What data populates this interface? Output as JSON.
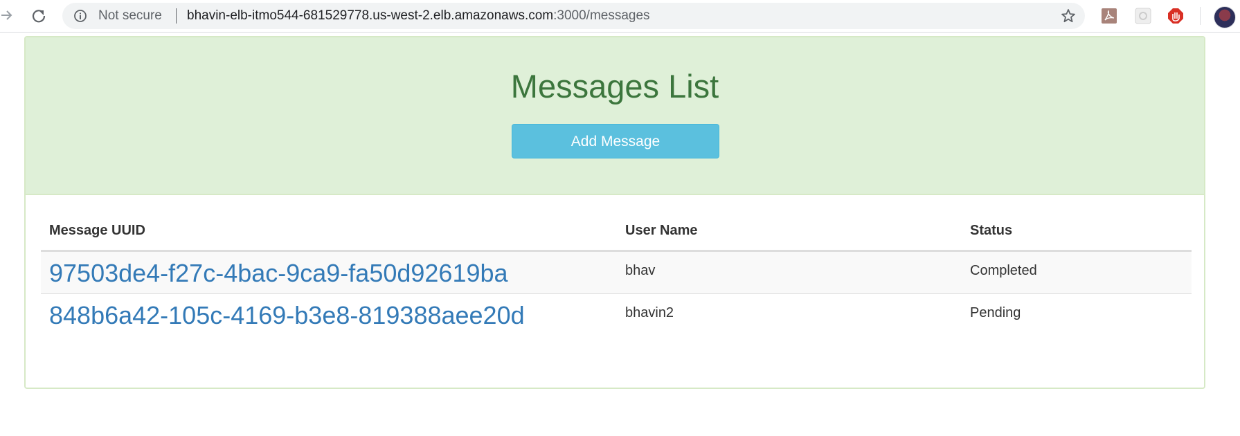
{
  "browser": {
    "security_label": "Not secure",
    "url_host": "bhavin-elb-itmo544-681529778.us-west-2.elb.amazonaws.com",
    "url_path": ":3000/messages",
    "extensions": [
      "pdf-icon",
      "extension-grey-icon",
      "stop-hand-icon"
    ]
  },
  "page": {
    "title": "Messages List",
    "add_button_label": "Add Message",
    "accent_color": "#3c763d",
    "heading_bg_color": "#dff0d8",
    "button_color": "#5bc0de",
    "link_color": "#337ab7"
  },
  "table": {
    "headers": [
      "Message UUID",
      "User Name",
      "Status"
    ],
    "rows": [
      {
        "uuid": "97503de4-f27c-4bac-9ca9-fa50d92619ba",
        "user": "bhav",
        "status": "Completed"
      },
      {
        "uuid": "848b6a42-105c-4169-b3e8-819388aee20d",
        "user": "bhavin2",
        "status": "Pending"
      }
    ]
  }
}
